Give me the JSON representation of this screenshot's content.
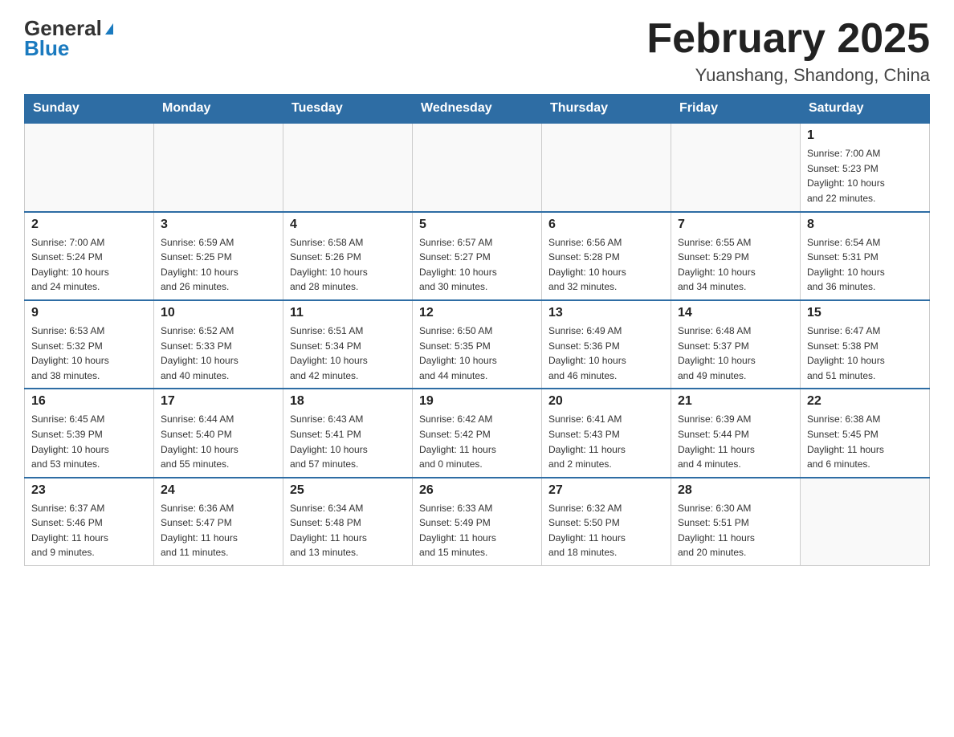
{
  "header": {
    "logo_general": "General",
    "logo_blue": "Blue",
    "month_title": "February 2025",
    "location": "Yuanshang, Shandong, China"
  },
  "days_of_week": [
    "Sunday",
    "Monday",
    "Tuesday",
    "Wednesday",
    "Thursday",
    "Friday",
    "Saturday"
  ],
  "weeks": [
    [
      {
        "day": "",
        "info": ""
      },
      {
        "day": "",
        "info": ""
      },
      {
        "day": "",
        "info": ""
      },
      {
        "day": "",
        "info": ""
      },
      {
        "day": "",
        "info": ""
      },
      {
        "day": "",
        "info": ""
      },
      {
        "day": "1",
        "info": "Sunrise: 7:00 AM\nSunset: 5:23 PM\nDaylight: 10 hours\nand 22 minutes."
      }
    ],
    [
      {
        "day": "2",
        "info": "Sunrise: 7:00 AM\nSunset: 5:24 PM\nDaylight: 10 hours\nand 24 minutes."
      },
      {
        "day": "3",
        "info": "Sunrise: 6:59 AM\nSunset: 5:25 PM\nDaylight: 10 hours\nand 26 minutes."
      },
      {
        "day": "4",
        "info": "Sunrise: 6:58 AM\nSunset: 5:26 PM\nDaylight: 10 hours\nand 28 minutes."
      },
      {
        "day": "5",
        "info": "Sunrise: 6:57 AM\nSunset: 5:27 PM\nDaylight: 10 hours\nand 30 minutes."
      },
      {
        "day": "6",
        "info": "Sunrise: 6:56 AM\nSunset: 5:28 PM\nDaylight: 10 hours\nand 32 minutes."
      },
      {
        "day": "7",
        "info": "Sunrise: 6:55 AM\nSunset: 5:29 PM\nDaylight: 10 hours\nand 34 minutes."
      },
      {
        "day": "8",
        "info": "Sunrise: 6:54 AM\nSunset: 5:31 PM\nDaylight: 10 hours\nand 36 minutes."
      }
    ],
    [
      {
        "day": "9",
        "info": "Sunrise: 6:53 AM\nSunset: 5:32 PM\nDaylight: 10 hours\nand 38 minutes."
      },
      {
        "day": "10",
        "info": "Sunrise: 6:52 AM\nSunset: 5:33 PM\nDaylight: 10 hours\nand 40 minutes."
      },
      {
        "day": "11",
        "info": "Sunrise: 6:51 AM\nSunset: 5:34 PM\nDaylight: 10 hours\nand 42 minutes."
      },
      {
        "day": "12",
        "info": "Sunrise: 6:50 AM\nSunset: 5:35 PM\nDaylight: 10 hours\nand 44 minutes."
      },
      {
        "day": "13",
        "info": "Sunrise: 6:49 AM\nSunset: 5:36 PM\nDaylight: 10 hours\nand 46 minutes."
      },
      {
        "day": "14",
        "info": "Sunrise: 6:48 AM\nSunset: 5:37 PM\nDaylight: 10 hours\nand 49 minutes."
      },
      {
        "day": "15",
        "info": "Sunrise: 6:47 AM\nSunset: 5:38 PM\nDaylight: 10 hours\nand 51 minutes."
      }
    ],
    [
      {
        "day": "16",
        "info": "Sunrise: 6:45 AM\nSunset: 5:39 PM\nDaylight: 10 hours\nand 53 minutes."
      },
      {
        "day": "17",
        "info": "Sunrise: 6:44 AM\nSunset: 5:40 PM\nDaylight: 10 hours\nand 55 minutes."
      },
      {
        "day": "18",
        "info": "Sunrise: 6:43 AM\nSunset: 5:41 PM\nDaylight: 10 hours\nand 57 minutes."
      },
      {
        "day": "19",
        "info": "Sunrise: 6:42 AM\nSunset: 5:42 PM\nDaylight: 11 hours\nand 0 minutes."
      },
      {
        "day": "20",
        "info": "Sunrise: 6:41 AM\nSunset: 5:43 PM\nDaylight: 11 hours\nand 2 minutes."
      },
      {
        "day": "21",
        "info": "Sunrise: 6:39 AM\nSunset: 5:44 PM\nDaylight: 11 hours\nand 4 minutes."
      },
      {
        "day": "22",
        "info": "Sunrise: 6:38 AM\nSunset: 5:45 PM\nDaylight: 11 hours\nand 6 minutes."
      }
    ],
    [
      {
        "day": "23",
        "info": "Sunrise: 6:37 AM\nSunset: 5:46 PM\nDaylight: 11 hours\nand 9 minutes."
      },
      {
        "day": "24",
        "info": "Sunrise: 6:36 AM\nSunset: 5:47 PM\nDaylight: 11 hours\nand 11 minutes."
      },
      {
        "day": "25",
        "info": "Sunrise: 6:34 AM\nSunset: 5:48 PM\nDaylight: 11 hours\nand 13 minutes."
      },
      {
        "day": "26",
        "info": "Sunrise: 6:33 AM\nSunset: 5:49 PM\nDaylight: 11 hours\nand 15 minutes."
      },
      {
        "day": "27",
        "info": "Sunrise: 6:32 AM\nSunset: 5:50 PM\nDaylight: 11 hours\nand 18 minutes."
      },
      {
        "day": "28",
        "info": "Sunrise: 6:30 AM\nSunset: 5:51 PM\nDaylight: 11 hours\nand 20 minutes."
      },
      {
        "day": "",
        "info": ""
      }
    ]
  ]
}
